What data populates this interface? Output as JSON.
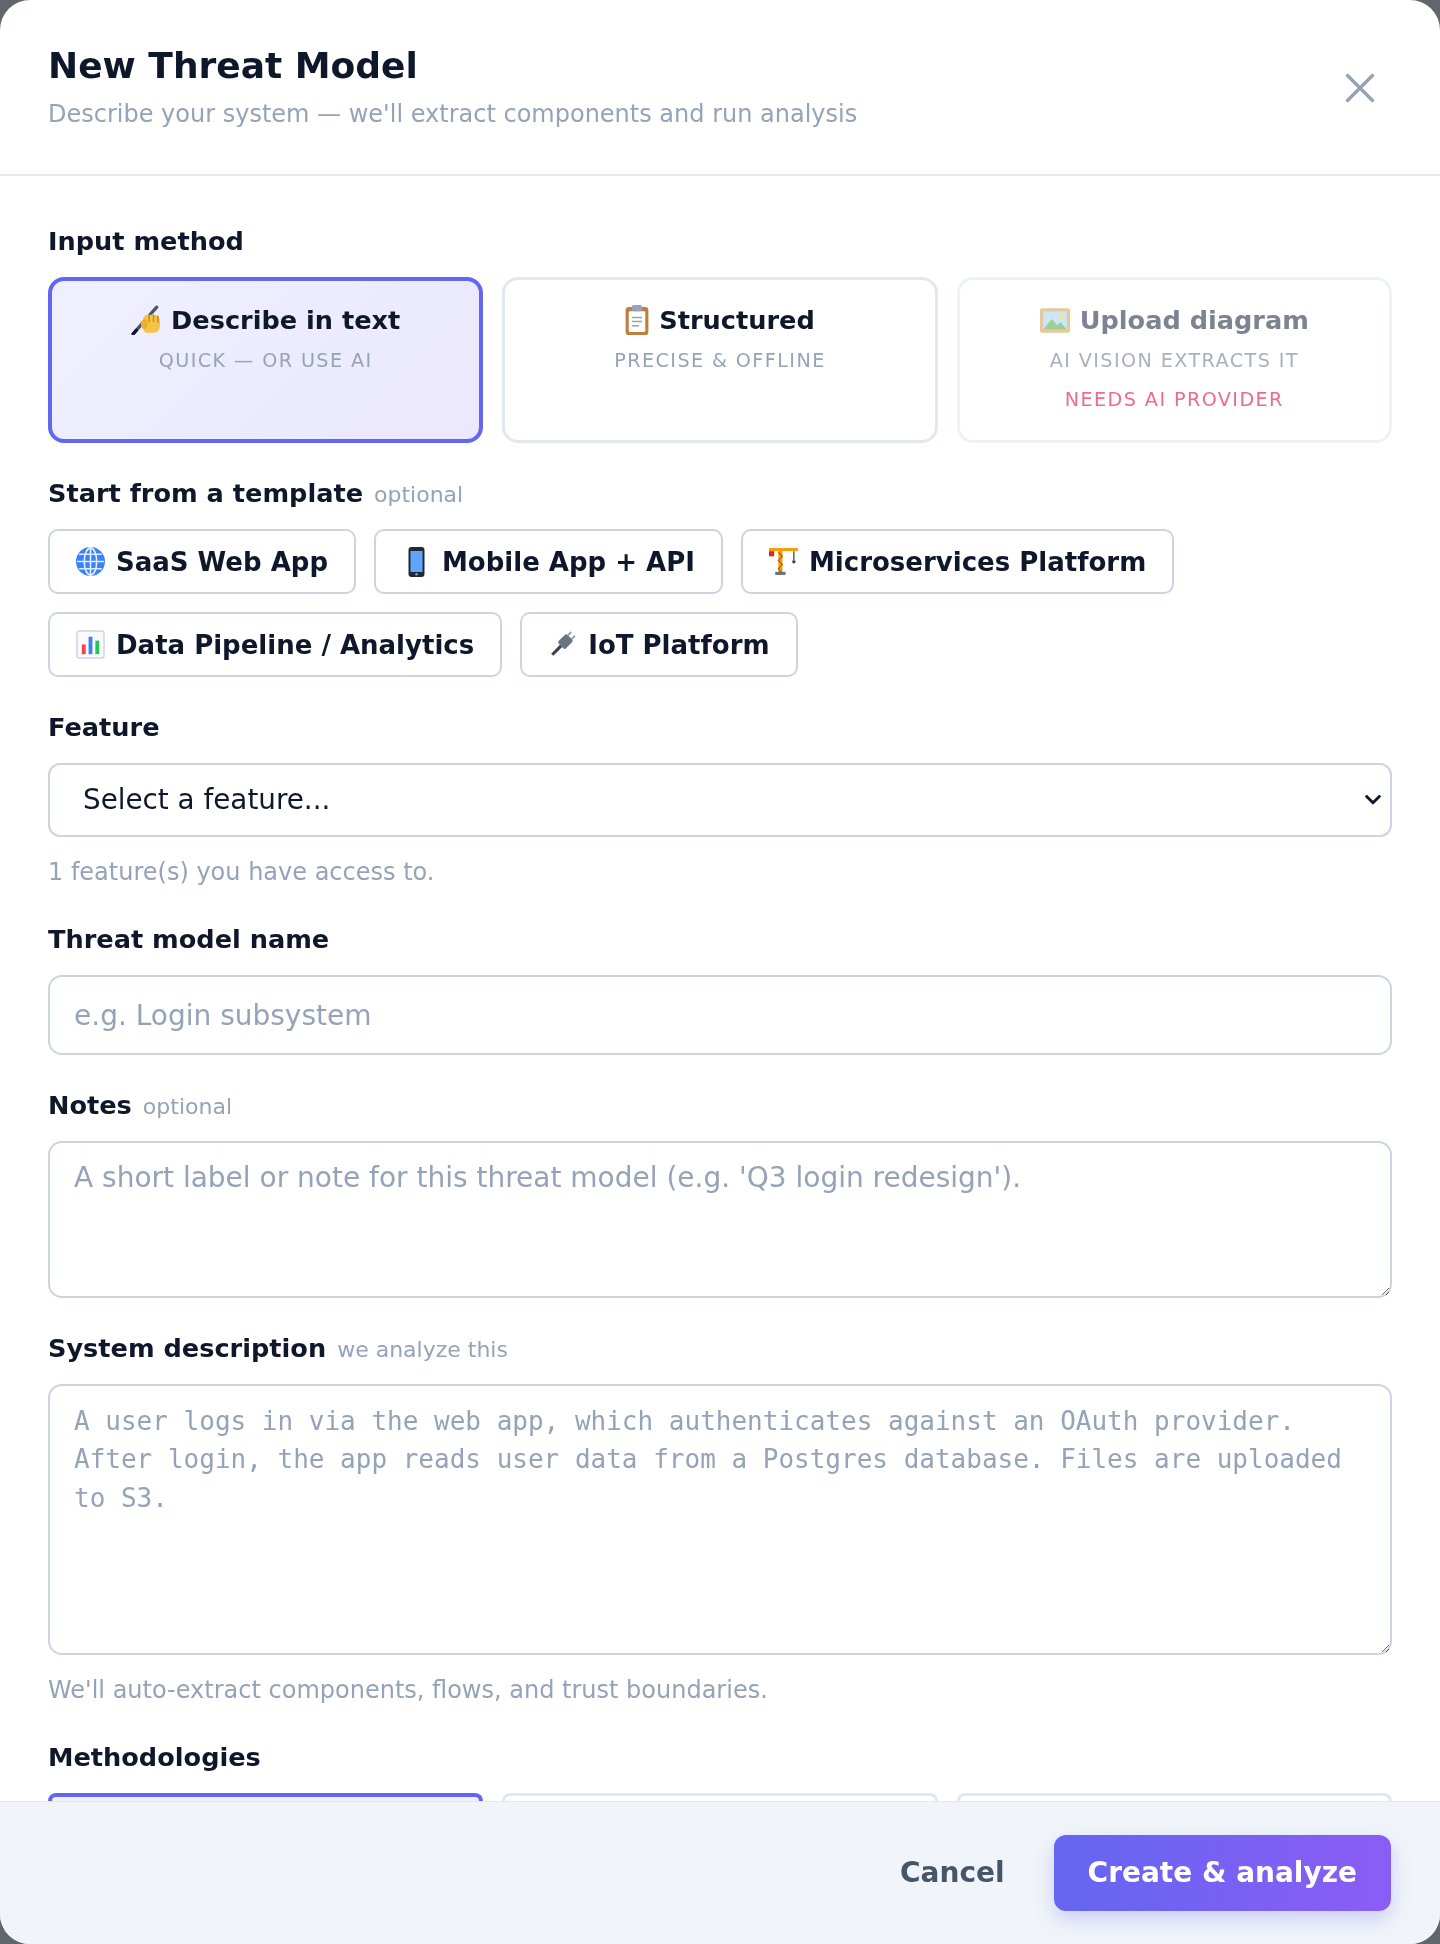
{
  "header": {
    "title": "New Threat Model",
    "subtitle": "Describe your system — we'll extract components and run analysis"
  },
  "input_method": {
    "label": "Input method",
    "options": [
      {
        "title": "Describe in text",
        "subtitle": "QUICK — OR USE AI",
        "selected": true,
        "disabled": false
      },
      {
        "title": "Structured",
        "subtitle": "PRECISE & OFFLINE",
        "selected": false,
        "disabled": false
      },
      {
        "title": "Upload diagram",
        "subtitle": "AI VISION EXTRACTS IT",
        "note": "NEEDS AI PROVIDER",
        "selected": false,
        "disabled": true
      }
    ]
  },
  "templates": {
    "label": "Start from a template",
    "hint": "optional",
    "items": [
      "SaaS Web App",
      "Mobile App + API",
      "Microservices Platform",
      "Data Pipeline / Analytics",
      "IoT Platform"
    ]
  },
  "feature": {
    "label": "Feature",
    "value": "Select a feature...",
    "help": "1 feature(s) you have access to."
  },
  "name": {
    "label": "Threat model name",
    "placeholder": "e.g. Login subsystem"
  },
  "notes": {
    "label": "Notes",
    "hint": "optional",
    "placeholder": "A short label or note for this threat model (e.g. 'Q3 login redesign')."
  },
  "system_description": {
    "label": "System description",
    "hint": "we analyze this",
    "placeholder": "A user logs in via the web app, which authenticates against an OAuth provider. After login, the app reads user data from a Postgres database. Files are uploaded to S3.",
    "help": "We'll auto-extract components, flows, and trust boundaries."
  },
  "methodologies": {
    "label": "Methodologies",
    "options": [
      {
        "selected": true
      },
      {
        "selected": false
      },
      {
        "selected": false
      }
    ]
  },
  "footer": {
    "buttons": [
      {
        "label": "Cancel",
        "kind": "secondary"
      },
      {
        "label": "Create & analyze",
        "kind": "primary"
      }
    ]
  }
}
